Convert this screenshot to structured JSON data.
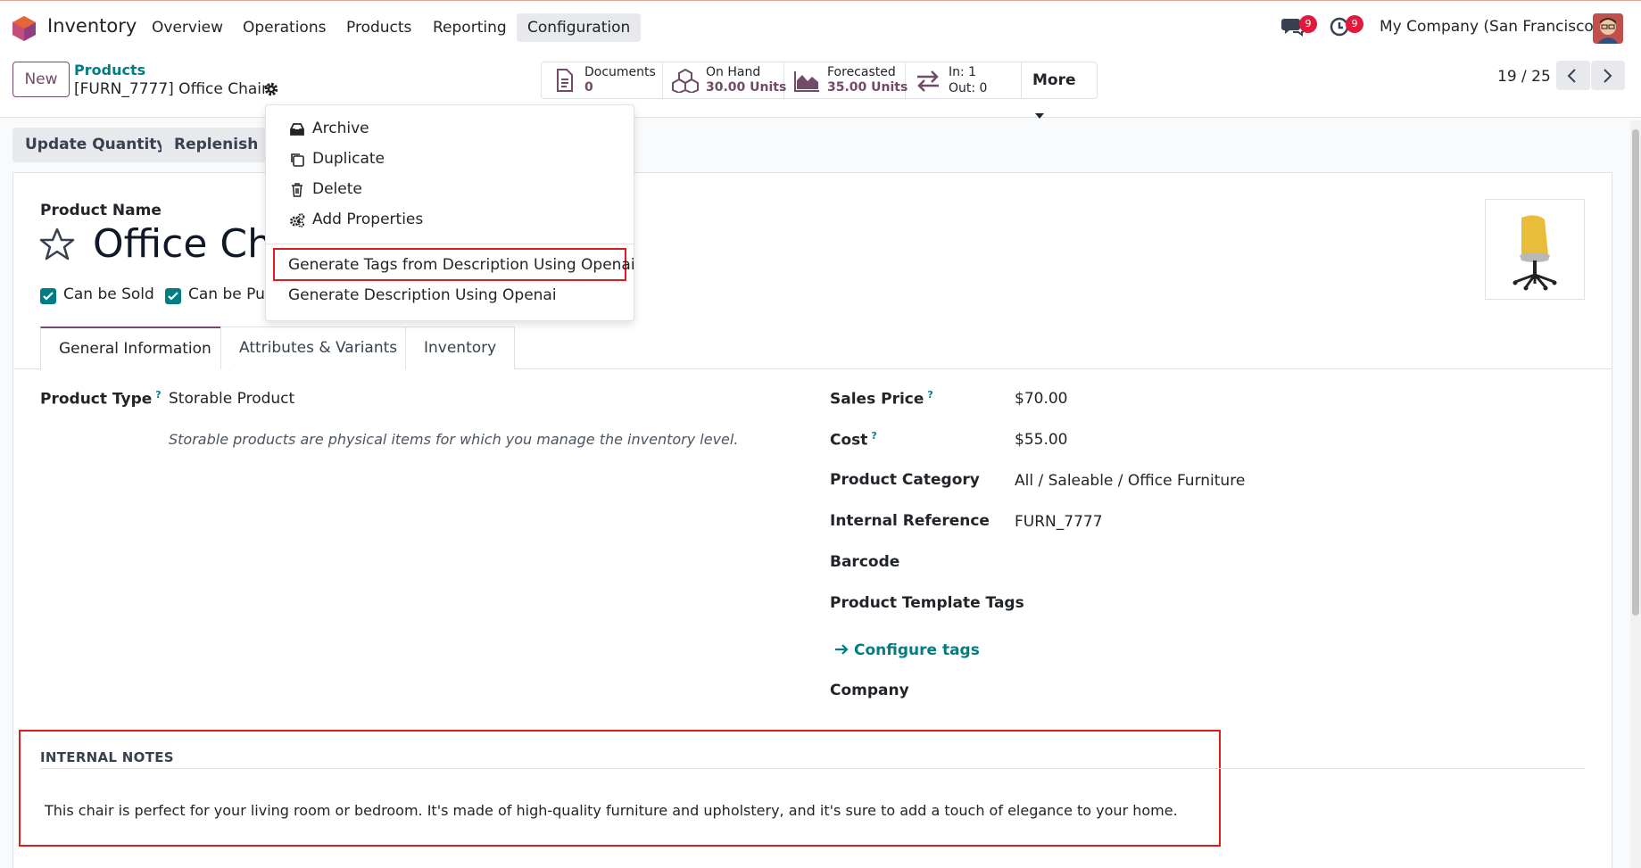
{
  "navbar": {
    "app_name": "Inventory",
    "menu": [
      "Overview",
      "Operations",
      "Products",
      "Reporting",
      "Configuration"
    ],
    "active_menu": "Configuration",
    "messages_badge": "9",
    "activities_badge": "9",
    "company": "My Company (San Francisco)"
  },
  "control": {
    "new_label": "New",
    "breadcrumb": "Products",
    "record_title": "[FURN_7777] Office Chair",
    "stats": {
      "documents_label": "Documents",
      "documents_value": "0",
      "onhand_label": "On Hand",
      "onhand_value": "30.00 Units",
      "forecasted_label": "Forecasted",
      "forecasted_value": "35.00 Units",
      "in_label": "In: 1",
      "out_label": "Out: 0",
      "more_label": "More"
    },
    "pager": "19 / 25"
  },
  "actions": {
    "update_quantity": "Update Quantity",
    "replenish": "Replenish"
  },
  "dropdown": {
    "archive": "Archive",
    "duplicate": "Duplicate",
    "delete": "Delete",
    "add_properties": "Add Properties",
    "generate_tags": "Generate Tags from Description Using Openai",
    "generate_description": "Generate Description Using Openai"
  },
  "form": {
    "product_name_label": "Product Name",
    "product_name": "Office Cha",
    "can_be_sold": "Can be Sold",
    "can_be_purchased": "Can be Pur",
    "tabs": [
      "General Information",
      "Attributes & Variants",
      "Inventory"
    ],
    "product_type_label": "Product Type",
    "product_type_value": "Storable Product",
    "product_type_note": "Storable products are physical items for which you manage the inventory level.",
    "sales_price_label": "Sales Price",
    "sales_price_value": "$70.00",
    "cost_label": "Cost",
    "cost_value": "$55.00",
    "category_label": "Product Category",
    "category_value": "All / Saleable / Office Furniture",
    "internal_ref_label": "Internal Reference",
    "internal_ref_value": "FURN_7777",
    "barcode_label": "Barcode",
    "template_tags_label": "Product Template Tags",
    "configure_tags": "Configure tags",
    "company_label": "Company",
    "help_mark": "?"
  },
  "notes": {
    "title": "INTERNAL NOTES",
    "text": "This chair is perfect for your living room or bedroom. It's made of high-quality furniture and upholstery, and it's sure to add a touch of elegance to your home."
  },
  "colors": {
    "brand": "#714b67",
    "accent": "#017e84",
    "highlight_border": "#dd1c1c",
    "badge": "#e0193d"
  }
}
